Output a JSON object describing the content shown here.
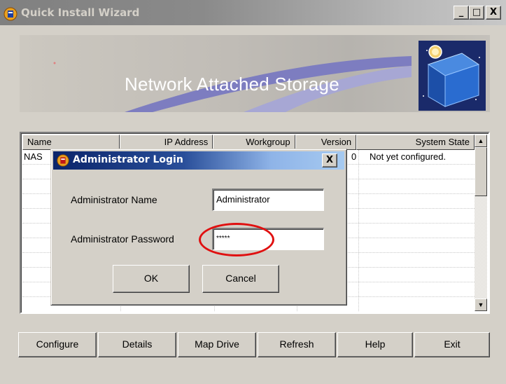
{
  "window": {
    "title": "Quick Install Wizard",
    "controls": {
      "minimize": "_",
      "maximize": "□",
      "close": "X"
    }
  },
  "banner": {
    "title": "Network Attached Storage"
  },
  "list": {
    "columns": [
      "Name",
      "IP Address",
      "Workgroup",
      "Version",
      "System State"
    ],
    "rows": [
      {
        "name": "NAS",
        "ip": "",
        "workgroup": "",
        "version": "0",
        "state": "Not yet configured."
      }
    ]
  },
  "buttons": [
    "Configure",
    "Details",
    "Map Drive",
    "Refresh",
    "Help",
    "Exit"
  ],
  "dialog": {
    "title": "Administrator Login",
    "close": "X",
    "name_label": "Administrator Name",
    "name_value": "Administrator",
    "password_label": "Administrator Password",
    "password_value": "*****",
    "ok": "OK",
    "cancel": "Cancel"
  },
  "colors": {
    "window_bg": "#d4d0c8",
    "dialog_title_start": "#0a246a",
    "dialog_title_end": "#a6caf0",
    "highlight": "#e01010"
  }
}
